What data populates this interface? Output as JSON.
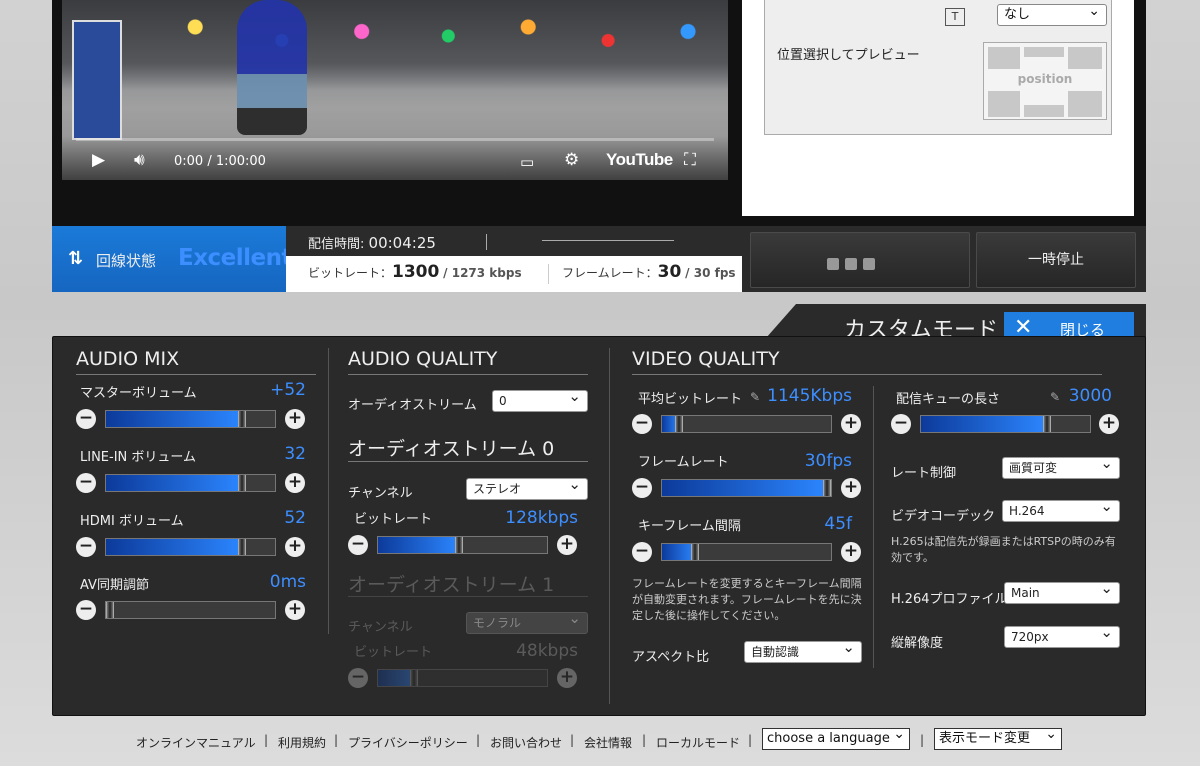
{
  "player": {
    "time": "0:00 / 1:00:00",
    "youtube_label": "YouTube",
    "play_icon": "play-icon",
    "volume_icon": "volume-icon",
    "subtitles_icon": "subtitles-icon",
    "settings_icon": "gear-icon",
    "fullscreen_icon": "fullscreen-icon"
  },
  "preview": {
    "text_overlay_select": "なし",
    "position_label": "位置選択してプレビュー",
    "position_grid_label": "position"
  },
  "status": {
    "line_label": "回線状態",
    "line_value": "Excellent",
    "duration_label": "配信時間:",
    "duration_value": "00:04:25",
    "bitrate_label": "ビットレート：",
    "bitrate_value": "1300",
    "bitrate_actual": "/ 1273 kbps",
    "framerate_label": "フレームレート：",
    "framerate_value": "30",
    "framerate_actual": "/ 30 fps",
    "pause_button": "一時停止"
  },
  "custom": {
    "title": "カスタムモード",
    "close_button": "閉じる"
  },
  "audio_mix": {
    "title": "AUDIO MIX",
    "items": [
      {
        "label": "マスターボリューム",
        "value": "+52",
        "level": 0.82
      },
      {
        "label": "LINE-IN ボリューム",
        "value": "32",
        "level": 0.82
      },
      {
        "label": "HDMI ボリューム",
        "value": "52",
        "level": 0.82
      },
      {
        "label": "AV同期調節",
        "value": "0ms",
        "level": 0.0
      }
    ]
  },
  "audio_quality": {
    "title": "AUDIO QUALITY",
    "stream_label": "オーディオストリーム",
    "stream_value": "0",
    "stream0_title": "オーディオストリーム 0",
    "channel_label": "チャンネル",
    "channel_value": "ステレオ",
    "bitrate_label": "ビットレート",
    "bitrate_value": "128kbps",
    "bitrate_level": 0.48,
    "stream1_title": "オーディオストリーム 1",
    "channel1_label": "チャンネル",
    "channel1_value": "モノラル",
    "bitrate1_label": "ビットレート",
    "bitrate1_value": "48kbps",
    "bitrate1_level": 0.2
  },
  "video_quality": {
    "title": "VIDEO QUALITY",
    "avg_bitrate_label": "平均ビットレート",
    "avg_bitrate_value": "1145Kbps",
    "avg_bitrate_level": 0.08,
    "framerate_label": "フレームレート",
    "framerate_value": "30fps",
    "framerate_level": 1.0,
    "keyframe_label": "キーフレーム間隔",
    "keyframe_value": "45f",
    "keyframe_level": 0.18,
    "note": "フレームレートを変更するとキーフレーム間隔が自動変更されます。フレームレートを先に決定した後に操作してください。",
    "aspect_label": "アスペクト比",
    "aspect_value": "自動認識",
    "queue_label": "配信キューの長さ",
    "queue_value": "3000",
    "queue_level": 0.76,
    "rate_control_label": "レート制御",
    "rate_control_value": "画質可変",
    "codec_label": "ビデオコーデック",
    "codec_value": "H.264",
    "codec_note": "H.265は配信先が録画またはRTSPの時のみ有効です。",
    "profile_label": "H.264プロファイル",
    "profile_value": "Main",
    "resolution_label": "縦解像度",
    "resolution_value": "720px"
  },
  "footer": {
    "links": [
      "オンラインマニュアル",
      "利用規約",
      "プライバシーポリシー",
      "お問い合わせ",
      "会社情報",
      "ローカルモード"
    ],
    "language_select": "choose a language",
    "display_mode_select": "表示モード変更"
  }
}
